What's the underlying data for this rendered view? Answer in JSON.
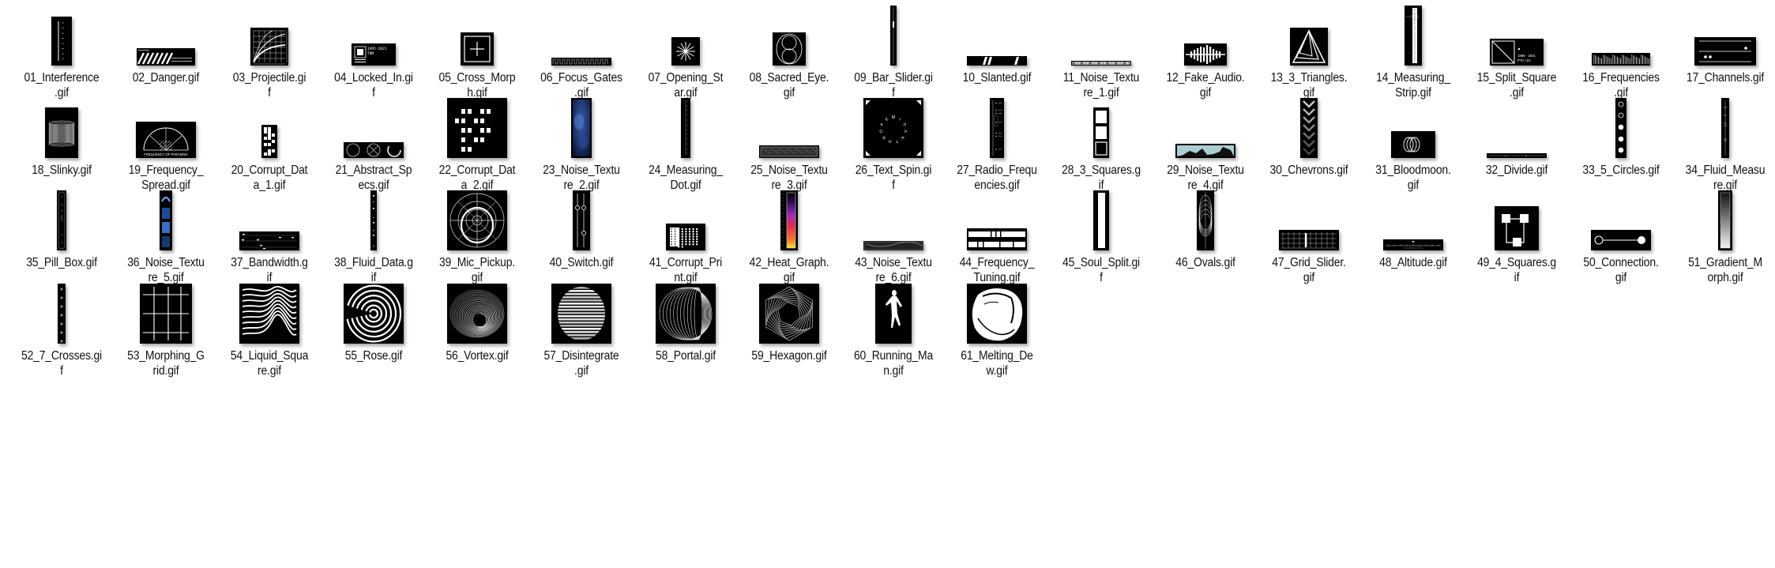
{
  "window": {
    "view": "Large icons",
    "folder_contents": "GIF animations"
  },
  "files": [
    {
      "name": "01_Interference.gif",
      "label_lines": [
        "01_Interference",
        ".gif"
      ],
      "thumb": "interference"
    },
    {
      "name": "02_Danger.gif",
      "label_lines": [
        "02_Danger.gif"
      ],
      "thumb": "danger"
    },
    {
      "name": "03_Projectile.gif",
      "label_lines": [
        "03_Projectile.gi",
        "f"
      ],
      "thumb": "projectile"
    },
    {
      "name": "04_Locked_In.gif",
      "label_lines": [
        "04_Locked_In.gi",
        "f"
      ],
      "thumb": "locked-in",
      "thumb_text": [
        "1995-2021",
        "TBM"
      ]
    },
    {
      "name": "05_Cross_Morph.gif",
      "label_lines": [
        "05_Cross_Morp",
        "h.gif"
      ],
      "thumb": "cross-morph"
    },
    {
      "name": "06_Focus_Gates.gif",
      "label_lines": [
        "06_Focus_Gates",
        ".gif"
      ],
      "thumb": "focus-gates"
    },
    {
      "name": "07_Opening_Star.gif",
      "label_lines": [
        "07_Opening_St",
        "ar.gif"
      ],
      "thumb": "opening-star"
    },
    {
      "name": "08_Sacred_Eye.gif",
      "label_lines": [
        "08_Sacred_Eye.",
        "gif"
      ],
      "thumb": "sacred-eye"
    },
    {
      "name": "09_Bar_Slider.gif",
      "label_lines": [
        "09_Bar_Slider.gi",
        "f"
      ],
      "thumb": "bar-slider"
    },
    {
      "name": "10_Slanted.gif",
      "label_lines": [
        "10_Slanted.gif"
      ],
      "thumb": "slanted"
    },
    {
      "name": "11_Noise_Texture_1.gif",
      "label_lines": [
        "11_Noise_Textu",
        "re_1.gif"
      ],
      "thumb": "noise-1"
    },
    {
      "name": "12_Fake_Audio.gif",
      "label_lines": [
        "12_Fake_Audio.",
        "gif"
      ],
      "thumb": "fake-audio"
    },
    {
      "name": "13_3_Triangles.gif",
      "label_lines": [
        "13_3_Triangles.",
        "gif"
      ],
      "thumb": "triangles"
    },
    {
      "name": "14_Measuring_Strip.gif",
      "label_lines": [
        "14_Measuring_",
        "Strip.gif"
      ],
      "thumb": "measuring-strip"
    },
    {
      "name": "15_Split_Square.gif",
      "label_lines": [
        "15_Split_Square",
        ".gif"
      ],
      "thumb": "split-square",
      "thumb_text": [
        "1995 - 2021",
        "PTA / ZA"
      ]
    },
    {
      "name": "16_Frequencies.gif",
      "label_lines": [
        "16_Frequencies",
        ".gif"
      ],
      "thumb": "frequencies"
    },
    {
      "name": "17_Channels.gif",
      "label_lines": [
        "17_Channels.gif"
      ],
      "thumb": "channels"
    },
    {
      "name": "18_Slinky.gif",
      "label_lines": [
        "18_Slinky.gif"
      ],
      "thumb": "slinky"
    },
    {
      "name": "19_Frequency_Spread.gif",
      "label_lines": [
        "19_Frequency_",
        "Spread.gif"
      ],
      "thumb": "frequency-spread",
      "thumb_text": [
        "FREQUENCY OF PARANOIA"
      ]
    },
    {
      "name": "20_Corrupt_Data_1.gif",
      "label_lines": [
        "20_Corrupt_Dat",
        "a_1.gif"
      ],
      "thumb": "corrupt-1"
    },
    {
      "name": "21_Abstract_Specs.gif",
      "label_lines": [
        "21_Abstract_Sp",
        "ecs.gif"
      ],
      "thumb": "abstract-specs"
    },
    {
      "name": "22_Corrupt_Data_2.gif",
      "label_lines": [
        "22_Corrupt_Dat",
        "a_2.gif"
      ],
      "thumb": "corrupt-2"
    },
    {
      "name": "23_Noise_Texture_2.gif",
      "label_lines": [
        "23_Noise_Textu",
        "re_2.gif"
      ],
      "thumb": "noise-2"
    },
    {
      "name": "24_Measuring_Dot.gif",
      "label_lines": [
        "24_Measuring_",
        "Dot.gif"
      ],
      "thumb": "measuring-dot"
    },
    {
      "name": "25_Noise_Texture_3.gif",
      "label_lines": [
        "25_Noise_Textu",
        "re_3.gif"
      ],
      "thumb": "noise-3"
    },
    {
      "name": "26_Text_Spin.gif",
      "label_lines": [
        "26_Text_Spin.gi",
        "f"
      ],
      "thumb": "text-spin",
      "thumb_text": [
        "MISANTHROPE"
      ]
    },
    {
      "name": "27_Radio_Frequencies.gif",
      "label_lines": [
        "27_Radio_Frequ",
        "encies.gif"
      ],
      "thumb": "radio-frequencies"
    },
    {
      "name": "28_3_Squares.gif",
      "label_lines": [
        "28_3_Squares.g",
        "if"
      ],
      "thumb": "three-squares"
    },
    {
      "name": "29_Noise_Texture_4.gif",
      "label_lines": [
        "29_Noise_Textu",
        "re_4.gif"
      ],
      "thumb": "noise-4"
    },
    {
      "name": "30_Chevrons.gif",
      "label_lines": [
        "30_Chevrons.gif"
      ],
      "thumb": "chevrons"
    },
    {
      "name": "31_Bloodmoon.gif",
      "label_lines": [
        "31_Bloodmoon.",
        "gif"
      ],
      "thumb": "bloodmoon"
    },
    {
      "name": "32_Divide.gif",
      "label_lines": [
        "32_Divide.gif"
      ],
      "thumb": "divide"
    },
    {
      "name": "33_5_Circles.gif",
      "label_lines": [
        "33_5_Circles.gif"
      ],
      "thumb": "five-circles"
    },
    {
      "name": "34_Fluid_Measure.gif",
      "label_lines": [
        "34_Fluid_Measu",
        "re.gif"
      ],
      "thumb": "fluid-measure"
    },
    {
      "name": "35_Pill_Box.gif",
      "label_lines": [
        "35_Pill_Box.gif"
      ],
      "thumb": "pill-box"
    },
    {
      "name": "36_Noise_Texture_5.gif",
      "label_lines": [
        "36_Noise_Textu",
        "re_5.gif"
      ],
      "thumb": "noise-5"
    },
    {
      "name": "37_Bandwidth.gif",
      "label_lines": [
        "37_Bandwidth.g",
        "if"
      ],
      "thumb": "bandwidth"
    },
    {
      "name": "38_Fluid_Data.gif",
      "label_lines": [
        "38_Fluid_Data.g",
        "if"
      ],
      "thumb": "fluid-data"
    },
    {
      "name": "39_Mic_Pickup.gif",
      "label_lines": [
        "39_Mic_Pickup.",
        "gif"
      ],
      "thumb": "mic-pickup"
    },
    {
      "name": "40_Switch.gif",
      "label_lines": [
        "40_Switch.gif"
      ],
      "thumb": "switch"
    },
    {
      "name": "41_Corrupt_Print.gif",
      "label_lines": [
        "41_Corrupt_Pri",
        "nt.gif"
      ],
      "thumb": "corrupt-print"
    },
    {
      "name": "42_Heat_Graph.gif",
      "label_lines": [
        "42_Heat_Graph.",
        "gif"
      ],
      "thumb": "heat-graph"
    },
    {
      "name": "43_Noise_Texture_6.gif",
      "label_lines": [
        "43_Noise_Textu",
        "re_6.gif"
      ],
      "thumb": "noise-6"
    },
    {
      "name": "44_Frequency_Tuning.gif",
      "label_lines": [
        "44_Frequency_",
        "Tuning.gif"
      ],
      "thumb": "frequency-tuning"
    },
    {
      "name": "45_Soul_Split.gif",
      "label_lines": [
        "45_Soul_Split.gi",
        "f"
      ],
      "thumb": "soul-split"
    },
    {
      "name": "46_Ovals.gif",
      "label_lines": [
        "46_Ovals.gif"
      ],
      "thumb": "ovals"
    },
    {
      "name": "47_Grid_Slider.gif",
      "label_lines": [
        "47_Grid_Slider.",
        "gif"
      ],
      "thumb": "grid-slider"
    },
    {
      "name": "48_Altitude.gif",
      "label_lines": [
        "48_Altitude.gif"
      ],
      "thumb": "altitude"
    },
    {
      "name": "49_4_Squares.gif",
      "label_lines": [
        "49_4_Squares.g",
        "if"
      ],
      "thumb": "four-squares"
    },
    {
      "name": "50_Connection.gif",
      "label_lines": [
        "50_Connection.",
        "gif"
      ],
      "thumb": "connection"
    },
    {
      "name": "51_Gradient_Morph.gif",
      "label_lines": [
        "51_Gradient_M",
        "orph.gif"
      ],
      "thumb": "gradient-morph"
    },
    {
      "name": "52_7_Crosses.gif",
      "label_lines": [
        "52_7_Crosses.gi",
        "f"
      ],
      "thumb": "seven-crosses"
    },
    {
      "name": "53_Morphing_Grid.gif",
      "label_lines": [
        "53_Morphing_G",
        "rid.gif"
      ],
      "thumb": "morphing-grid"
    },
    {
      "name": "54_Liquid_Square.gif",
      "label_lines": [
        "54_Liquid_Squa",
        "re.gif"
      ],
      "thumb": "liquid-square"
    },
    {
      "name": "55_Rose.gif",
      "label_lines": [
        "55_Rose.gif"
      ],
      "thumb": "rose"
    },
    {
      "name": "56_Vortex.gif",
      "label_lines": [
        "56_Vortex.gif"
      ],
      "thumb": "vortex"
    },
    {
      "name": "57_Disintegrate.gif",
      "label_lines": [
        "57_Disintegrate",
        ".gif"
      ],
      "thumb": "disintegrate"
    },
    {
      "name": "58_Portal.gif",
      "label_lines": [
        "58_Portal.gif"
      ],
      "thumb": "portal"
    },
    {
      "name": "59_Hexagon.gif",
      "label_lines": [
        "59_Hexagon.gif"
      ],
      "thumb": "hexagon"
    },
    {
      "name": "60_Running_Man.gif",
      "label_lines": [
        "60_Running_Ma",
        "n.gif"
      ],
      "thumb": "running-man"
    },
    {
      "name": "61_Melting_Dew.gif",
      "label_lines": [
        "61_Melting_De",
        "w.gif"
      ],
      "thumb": "melting-dew"
    }
  ]
}
